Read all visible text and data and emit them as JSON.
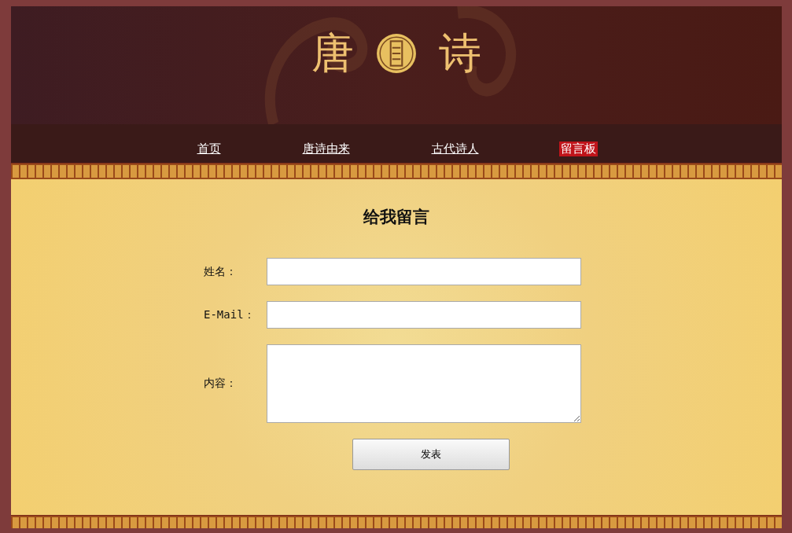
{
  "header": {
    "logo_left": "唐",
    "logo_right": "诗"
  },
  "nav": [
    {
      "label": "首页",
      "selected": false
    },
    {
      "label": "唐诗由来",
      "selected": false
    },
    {
      "label": "古代诗人",
      "selected": false
    },
    {
      "label": "留言板",
      "selected": true
    }
  ],
  "form": {
    "title": "给我留言",
    "fields": [
      {
        "label": "姓名：",
        "kind": "input"
      },
      {
        "label": "E-Mail：",
        "kind": "input"
      },
      {
        "label": "内容：",
        "kind": "textarea"
      }
    ],
    "submit": "发表"
  }
}
